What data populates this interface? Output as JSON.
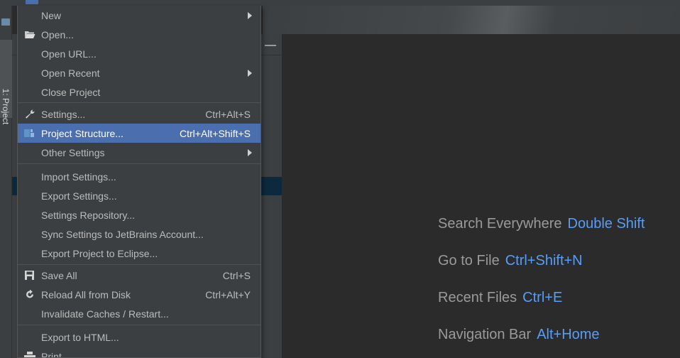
{
  "tool_window": {
    "tab_label": "1: Project"
  },
  "menu": {
    "items": [
      {
        "label": "New",
        "shortcut": "",
        "submenu": true
      },
      {
        "label": "Open...",
        "shortcut": "",
        "icon": "folder-open-icon"
      },
      {
        "label": "Open URL...",
        "shortcut": ""
      },
      {
        "label": "Open Recent",
        "shortcut": "",
        "submenu": true
      },
      {
        "label": "Close Project",
        "shortcut": ""
      },
      {
        "label": "Settings...",
        "shortcut": "Ctrl+Alt+S",
        "icon": "wrench-icon"
      },
      {
        "label": "Project Structure...",
        "shortcut": "Ctrl+Alt+Shift+S",
        "icon": "project-structure-icon",
        "selected": true
      },
      {
        "label": "Other Settings",
        "shortcut": "",
        "submenu": true
      },
      {
        "label": "Import Settings...",
        "shortcut": ""
      },
      {
        "label": "Export Settings...",
        "shortcut": ""
      },
      {
        "label": "Settings Repository...",
        "shortcut": ""
      },
      {
        "label": "Sync Settings to JetBrains Account...",
        "shortcut": ""
      },
      {
        "label": "Export Project to Eclipse...",
        "shortcut": ""
      },
      {
        "label": "Save All",
        "shortcut": "Ctrl+S",
        "icon": "save-icon"
      },
      {
        "label": "Reload All from Disk",
        "shortcut": "Ctrl+Alt+Y",
        "icon": "reload-icon"
      },
      {
        "label": "Invalidate Caches / Restart...",
        "shortcut": ""
      },
      {
        "label": "Export to HTML...",
        "shortcut": ""
      },
      {
        "label": "Print...",
        "shortcut": "",
        "icon": "print-icon"
      }
    ]
  },
  "hints": [
    {
      "action": "Search Everywhere",
      "key": "Double Shift"
    },
    {
      "action": "Go to File",
      "key": "Ctrl+Shift+N"
    },
    {
      "action": "Recent Files",
      "key": "Ctrl+E"
    },
    {
      "action": "Navigation Bar",
      "key": "Alt+Home"
    }
  ],
  "colors": {
    "menu_bg": "#3c3f41",
    "selection": "#4b6eaf",
    "hint_key": "#589df6",
    "hint_text": "#9a9a9a",
    "editor_bg": "#2b2b2b"
  }
}
